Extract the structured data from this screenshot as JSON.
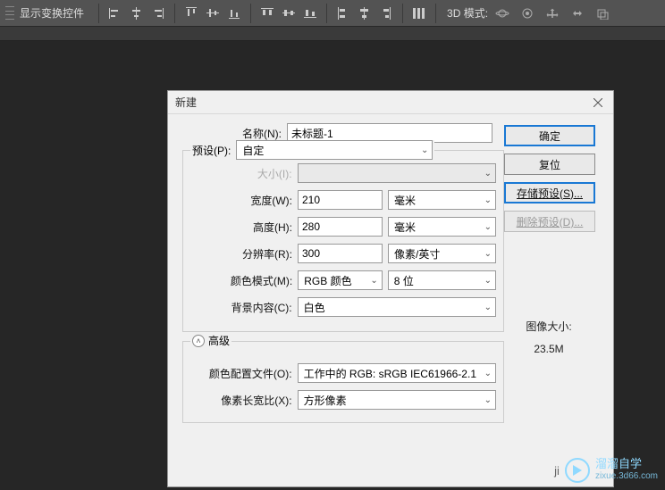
{
  "toolbar": {
    "transform_label": "显示变换控件",
    "mode_label": "3D 模式:"
  },
  "dialog": {
    "title": "新建",
    "name_label": "名称(N):",
    "name_value": "未标题-1",
    "preset_label": "预设(P):",
    "preset_value": "自定",
    "size_label": "大小(I):",
    "width_label": "宽度(W):",
    "width_value": "210",
    "width_unit": "毫米",
    "height_label": "高度(H):",
    "height_value": "280",
    "height_unit": "毫米",
    "resolution_label": "分辨率(R):",
    "resolution_value": "300",
    "resolution_unit": "像素/英寸",
    "color_mode_label": "颜色模式(M):",
    "color_mode_value": "RGB 颜色",
    "color_depth": "8 位",
    "bg_label": "背景内容(C):",
    "bg_value": "白色",
    "advanced_label": "高级",
    "profile_label": "颜色配置文件(O):",
    "profile_value": "工作中的 RGB: sRGB IEC61966-2.1",
    "aspect_label": "像素长宽比(X):",
    "aspect_value": "方形像素",
    "image_size_label": "图像大小:",
    "image_size_value": "23.5M",
    "buttons": {
      "ok": "确定",
      "reset": "复位",
      "save_preset": "存储预设(S)...",
      "delete_preset": "删除预设(D)..."
    }
  },
  "watermark": {
    "line1": "溜溜自学",
    "line2": "zixue.3d66.com"
  }
}
